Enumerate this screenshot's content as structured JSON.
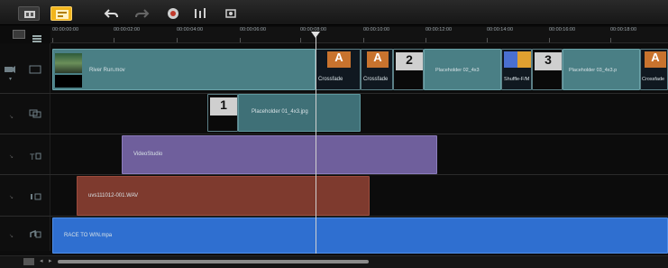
{
  "ruler": {
    "ticks": [
      "00:00:00:00",
      "00:00:02:00",
      "00:00:04:00",
      "00:00:06:00",
      "00:00:08:00",
      "00:00:10:00",
      "00:00:12:00",
      "00:00:14:00",
      "00:00:16:00",
      "00:00:18:00"
    ]
  },
  "tracks": {
    "video": {
      "river": "River Run.mov",
      "cross1": "Crossfade",
      "cross2": "Crossfade",
      "badge2": "2",
      "placeholder2": "Placeholder 02_4x3",
      "shuffle": "Shuffle-F/M",
      "badge3": "3",
      "placeholder3": "Placeholder 03_4x3.p",
      "cross3": "Crossfade"
    },
    "overlay": {
      "badge1": "1",
      "placeholder1": "Placeholder 01_4x3.jpg"
    },
    "title": {
      "label": "VideoStudio"
    },
    "voice": {
      "label": "uvs111012-001.WAV"
    },
    "music": {
      "label": "RACE TO WIN.mpa"
    }
  },
  "colors": {
    "accent": "#f2b51c",
    "video_clip": "#4a7f85",
    "title_clip": "#6f5f9c",
    "voice_clip": "#7e3a2e",
    "music_clip": "#2f6fd0"
  }
}
